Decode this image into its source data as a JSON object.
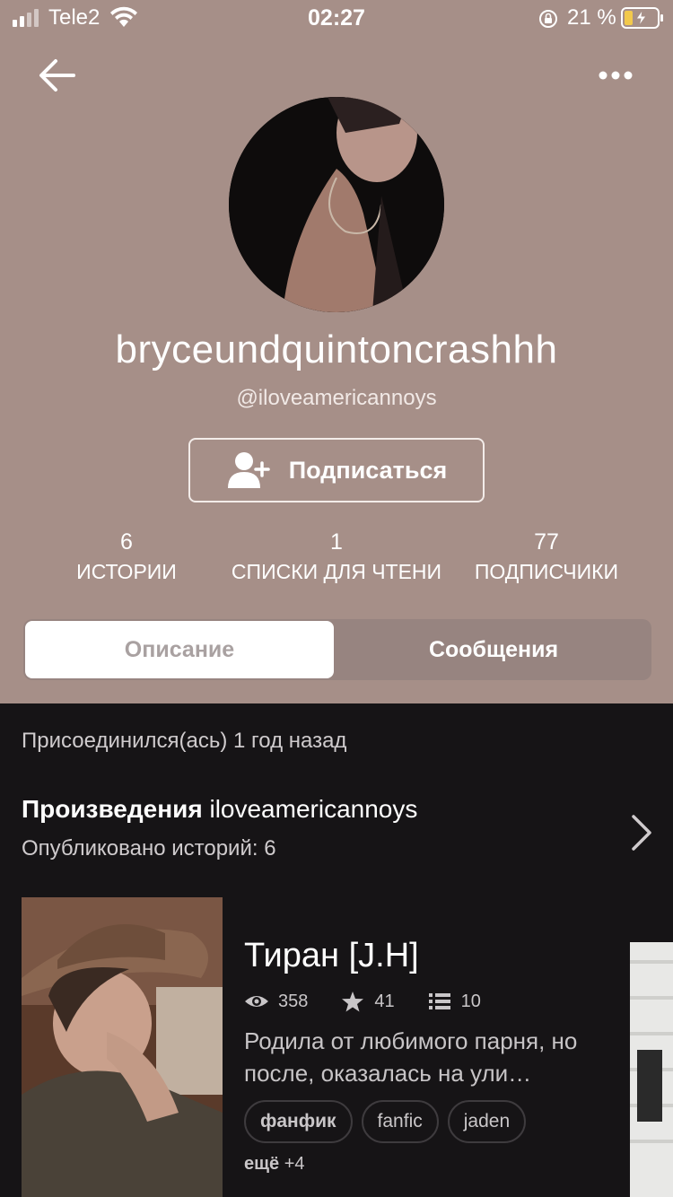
{
  "status_bar": {
    "carrier": "Tele2",
    "time": "02:27",
    "battery_percent": "21 %"
  },
  "profile": {
    "display_name": "bryceundquintoncrashhh",
    "handle": "@iloveamericannoys",
    "follow_label": "Подписаться"
  },
  "stats": [
    {
      "value": "6",
      "label": "ИСТОРИИ"
    },
    {
      "value": "1",
      "label": "СПИСКИ ДЛЯ ЧТЕНИ"
    },
    {
      "value": "77",
      "label": "ПОДПИСЧИКИ"
    }
  ],
  "tabs": {
    "about": "Описание",
    "messages": "Сообщения"
  },
  "about": {
    "joined": "Присоединился(ась) 1 год назад",
    "works_title_bold": "Произведения",
    "works_title_name": " iloveamericannoys",
    "works_subtitle": "Опубликовано историй: 6"
  },
  "story": {
    "title": "Тиран [J.H]",
    "views": "358",
    "votes": "41",
    "parts": "10",
    "description": "Родила от любимого парня, но после, оказалась на ули…",
    "tags": [
      "фанфик",
      "fanfic",
      "jaden"
    ],
    "more_label": "ещё",
    "more_count": "+4"
  },
  "colors": {
    "header_bg": "#a68f88",
    "page_bg": "#161416",
    "tab_active_bg": "#ffffff"
  }
}
